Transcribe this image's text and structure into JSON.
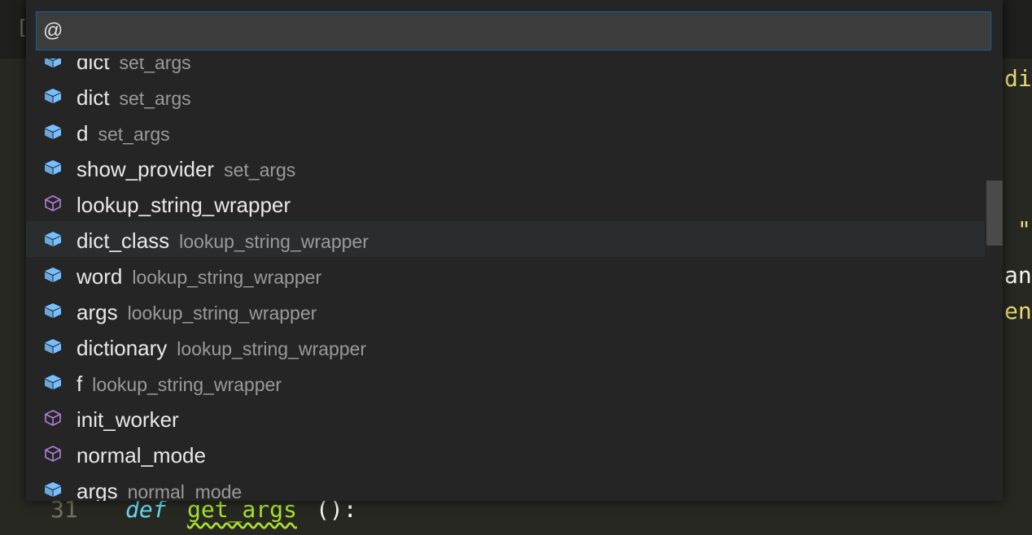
{
  "editor": {
    "topbar_glyph": "[",
    "right_fragments": [
      "di",
      "\"",
      "an",
      "en"
    ],
    "code_line": {
      "line_number": "31",
      "keyword": "def",
      "function_name": "get_args",
      "parens": "():"
    }
  },
  "quick_open": {
    "input_value": "@",
    "items": [
      {
        "label": "dict",
        "description": "set_args",
        "icon": "variable-icon"
      },
      {
        "label": "dict",
        "description": "set_args",
        "icon": "variable-icon"
      },
      {
        "label": "d",
        "description": "set_args",
        "icon": "variable-icon"
      },
      {
        "label": "show_provider",
        "description": "set_args",
        "icon": "variable-icon"
      },
      {
        "label": "lookup_string_wrapper",
        "description": "",
        "icon": "method-icon"
      },
      {
        "label": "dict_class",
        "description": "lookup_string_wrapper",
        "icon": "variable-icon",
        "selected": true
      },
      {
        "label": "word",
        "description": "lookup_string_wrapper",
        "icon": "variable-icon"
      },
      {
        "label": "args",
        "description": "lookup_string_wrapper",
        "icon": "variable-icon"
      },
      {
        "label": "dictionary",
        "description": "lookup_string_wrapper",
        "icon": "variable-icon"
      },
      {
        "label": "f",
        "description": "lookup_string_wrapper",
        "icon": "variable-icon"
      },
      {
        "label": "init_worker",
        "description": "",
        "icon": "method-icon"
      },
      {
        "label": "normal_mode",
        "description": "",
        "icon": "method-icon"
      },
      {
        "label": "args",
        "description": "normal_mode",
        "icon": "variable-icon"
      }
    ]
  },
  "colors": {
    "variable_icon": "#75beff",
    "method_icon": "#b180d7",
    "selection": "#2a2d2e",
    "input_border": "#0e639c"
  }
}
